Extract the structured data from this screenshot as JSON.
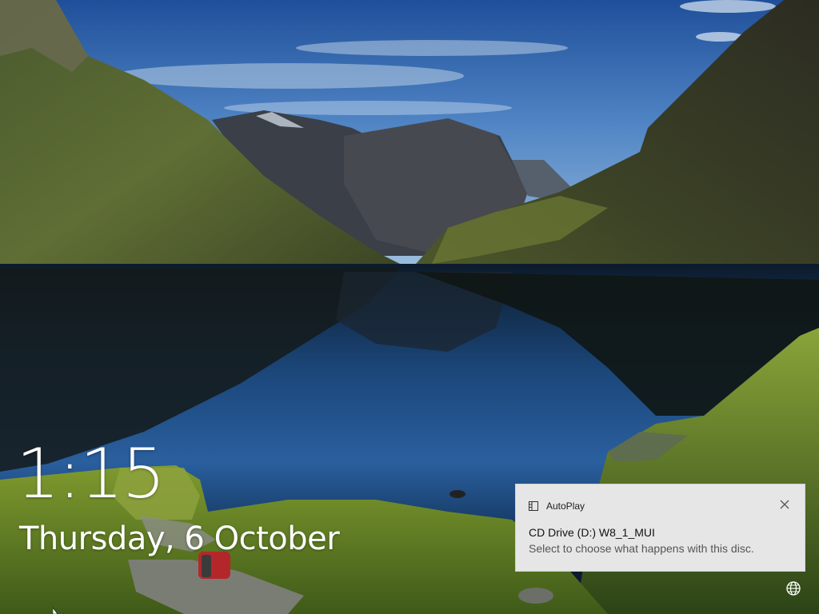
{
  "lockscreen": {
    "time": "1:15",
    "date": "Thursday, 6 October"
  },
  "notification": {
    "app_name": "AutoPlay",
    "title": "CD Drive (D:) W8_1_MUI",
    "body": "Select to choose what happens with this disc.",
    "app_icon": "autoplay-icon",
    "close_icon": "close-icon"
  },
  "status": {
    "network_icon": "globe-icon"
  },
  "colors": {
    "toast_background": "#e6e6e6",
    "text_primary": "#ffffff"
  }
}
